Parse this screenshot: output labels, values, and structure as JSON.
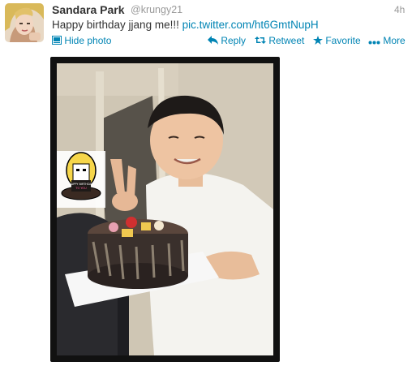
{
  "tweet": {
    "author_name": "Sandara Park",
    "handle": "@krungy21",
    "time": "4h",
    "text_body": "Happy birthday jjang me!!! ",
    "text_link": "pic.twitter.com/ht6GmtNupH",
    "actions": {
      "hide_photo": "Hide photo",
      "reply": "Reply",
      "retweet": "Retweet",
      "favorite": "Favorite",
      "more": "More"
    }
  },
  "colors": {
    "link": "#0084b4",
    "name": "#333333",
    "meta": "#999999",
    "photo_frame": "#111111"
  },
  "icons": {
    "hide_photo": "photo-icon",
    "reply": "reply-arrow-icon",
    "retweet": "retweet-icon",
    "favorite": "star-icon",
    "more": "dots-icon"
  },
  "sticker": {
    "text": "HAPPY BIRTHDAY TO YOU"
  }
}
